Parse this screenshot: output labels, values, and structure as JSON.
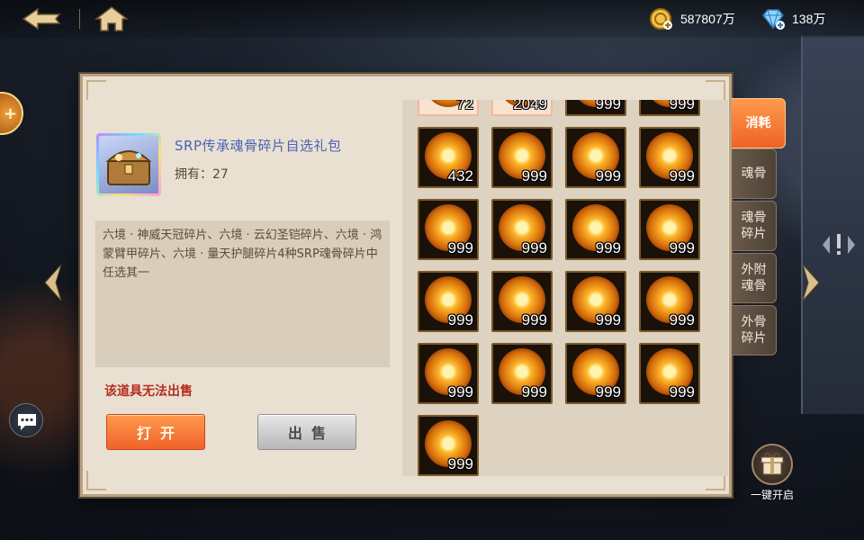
{
  "resources": {
    "gold": {
      "icon": "gold-coin-plus-icon",
      "value": "587807万"
    },
    "diamond": {
      "icon": "diamond-plus-icon",
      "value": "138万"
    }
  },
  "item": {
    "name": "SRP传承魂骨碎片自选礼包",
    "owned": "拥有：27",
    "description": "六境 · 神威天冠碎片、六境 · 云幻圣铠碎片、六境 · 鸿蒙臂甲碎片、六境 · 量天护腿碎片4种SRP魂骨碎片中任选其一",
    "cannot_sell": "该道具无法出售"
  },
  "buttons": {
    "open": "打开",
    "sell": "出售"
  },
  "grid": {
    "partial_row": [
      "72",
      "2049",
      "999",
      "999"
    ],
    "rows": [
      [
        "432",
        "999",
        "999",
        "999"
      ],
      [
        "999",
        "999",
        "999",
        "999"
      ],
      [
        "999",
        "999",
        "999",
        "999"
      ],
      [
        "999",
        "999",
        "999",
        "999"
      ],
      [
        "999"
      ]
    ]
  },
  "tabs": [
    {
      "label": "消耗",
      "active": true
    },
    {
      "label": "魂骨",
      "active": false
    },
    {
      "label": "魂骨\n碎片",
      "active": false
    },
    {
      "label": "外附\n魂骨",
      "active": false
    },
    {
      "label": "外骨\n碎片",
      "active": false
    }
  ],
  "one_click_open": "一键开启",
  "colors": {
    "accent_orange": "#f0622a",
    "item_name_blue": "#4a63b8",
    "warning_red": "#b52c1c",
    "panel_bg": "#e9e0d1"
  }
}
